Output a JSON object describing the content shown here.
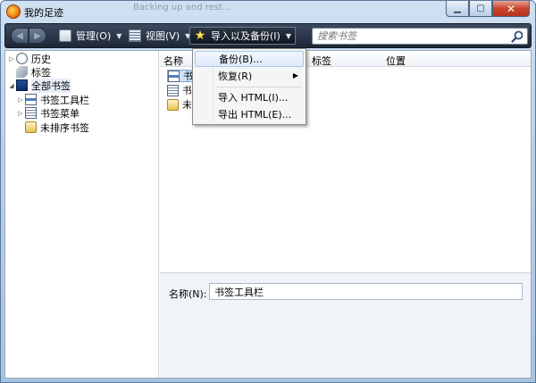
{
  "window": {
    "title": "我的足迹",
    "background_tab_title": "Backing up and rest..."
  },
  "toolbar": {
    "back_label": "◀",
    "forward_label": "▶",
    "manage_label": "管理(O)",
    "view_label": "视图(V)",
    "import_backup_label": "导入以及备份(I)",
    "search_placeholder": "搜索书签"
  },
  "sidebar": {
    "items": [
      {
        "label": "历史",
        "icon": "history-icon"
      },
      {
        "label": "标签",
        "icon": "tag-icon"
      },
      {
        "label": "全部书签",
        "icon": "all-bookmarks-icon"
      },
      {
        "label": "书签工具栏",
        "icon": "bookmarks-toolbar-icon"
      },
      {
        "label": "书签菜单",
        "icon": "bookmarks-menu-icon"
      },
      {
        "label": "未排序书签",
        "icon": "unsorted-bookmarks-icon"
      }
    ]
  },
  "columns": {
    "name": "名称",
    "tags": "标签",
    "location": "位置"
  },
  "rows": [
    {
      "label": "书签工具栏",
      "icon": "bookmarks-toolbar-icon"
    },
    {
      "label": "书签菜单",
      "icon": "bookmarks-menu-icon"
    },
    {
      "label": "未排序书签",
      "icon": "unsorted-bookmarks-icon"
    }
  ],
  "detail": {
    "name_label": "名称(N):",
    "name_value": "书签工具栏"
  },
  "menu": {
    "items": [
      {
        "label": "备份(B)..."
      },
      {
        "label": "恢复(R)"
      },
      {
        "label": "导入 HTML(I)..."
      },
      {
        "label": "导出 HTML(E)..."
      }
    ]
  }
}
